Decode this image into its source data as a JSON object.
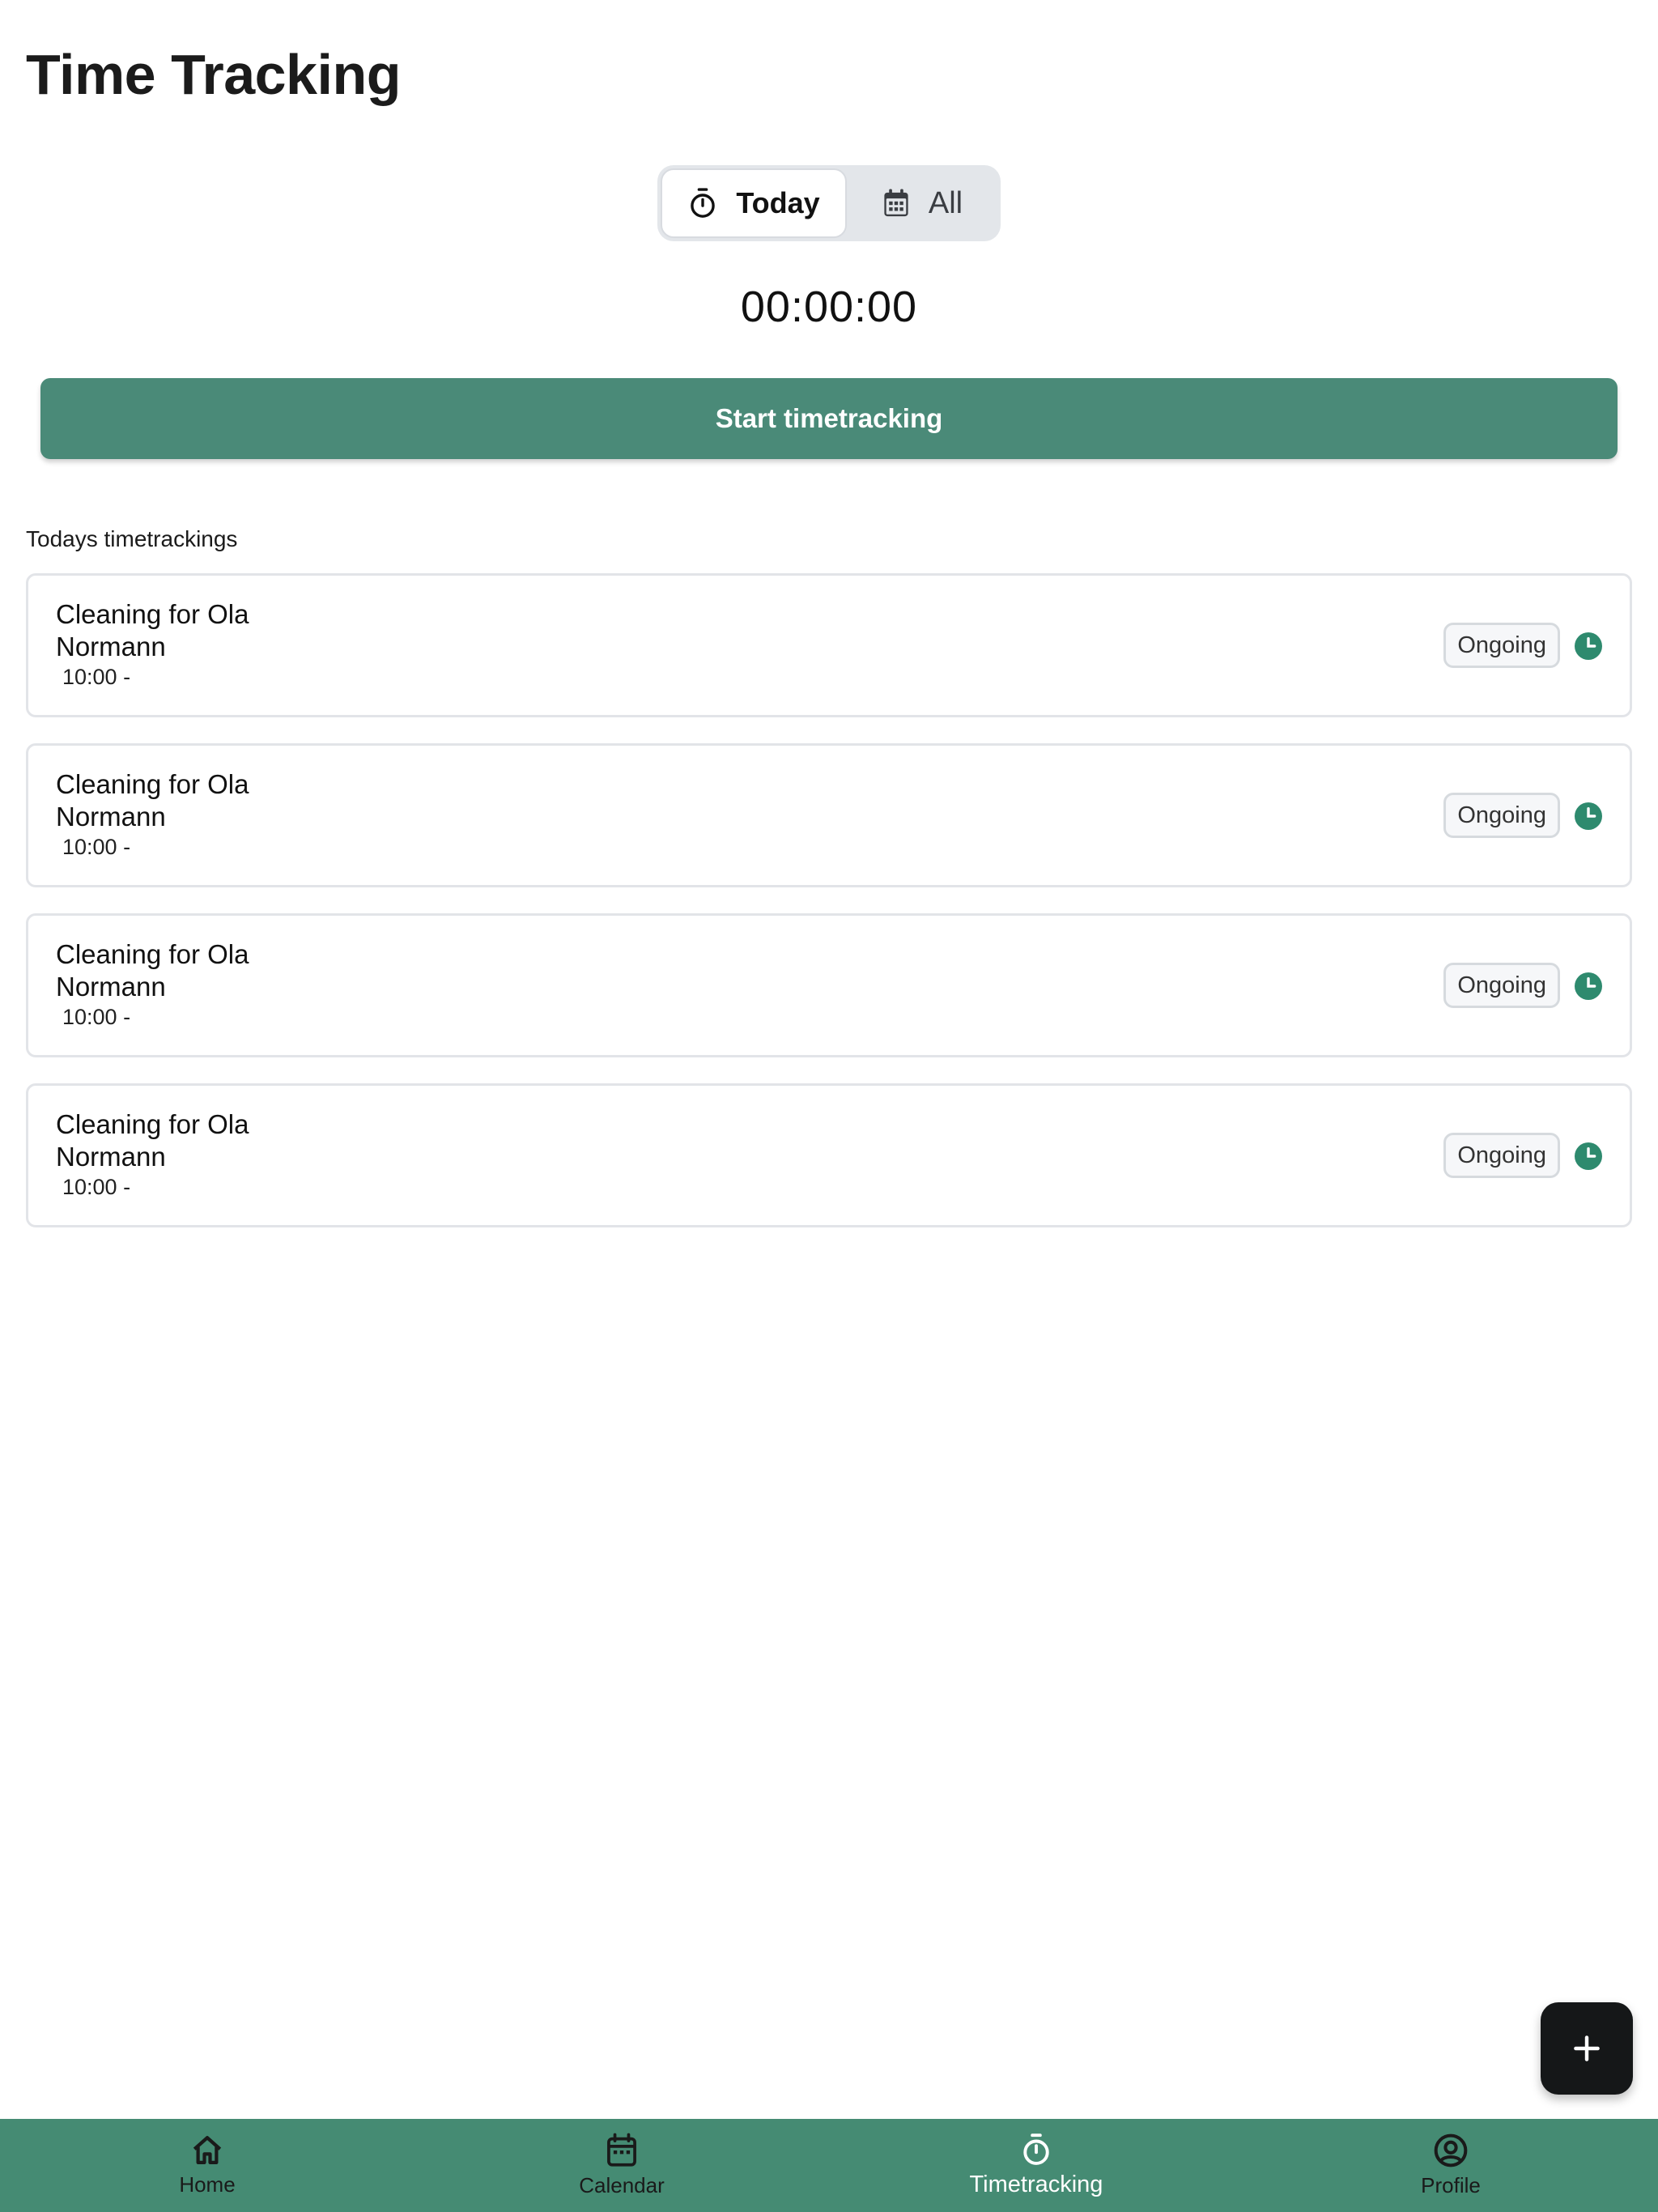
{
  "header": {
    "title": "Time Tracking"
  },
  "view_toggle": {
    "options": [
      {
        "label": "Today",
        "icon": "stopwatch-icon",
        "selected": true
      },
      {
        "label": "All",
        "icon": "calendar-icon",
        "selected": false
      }
    ]
  },
  "timer": {
    "value": "00:00:00"
  },
  "start_button": {
    "label": "Start timetracking"
  },
  "section": {
    "label": "Todays timetrackings"
  },
  "entries": [
    {
      "title": "Cleaning for Ola Normann",
      "time": "10:00 -",
      "status": "Ongoing",
      "status_icon": "clock-icon"
    },
    {
      "title": "Cleaning for Ola Normann",
      "time": "10:00 -",
      "status": "Ongoing",
      "status_icon": "clock-icon"
    },
    {
      "title": "Cleaning for Ola Normann",
      "time": "10:00 -",
      "status": "Ongoing",
      "status_icon": "clock-icon"
    },
    {
      "title": "Cleaning for Ola Normann",
      "time": "10:00 -",
      "status": "Ongoing",
      "status_icon": "clock-icon"
    }
  ],
  "fab": {
    "icon": "plus-icon"
  },
  "bottom_nav": {
    "items": [
      {
        "label": "Home",
        "icon": "home-icon",
        "active": false
      },
      {
        "label": "Calendar",
        "icon": "calendar-icon",
        "active": false
      },
      {
        "label": "Timetracking",
        "icon": "stopwatch-icon",
        "active": true
      },
      {
        "label": "Profile",
        "icon": "profile-icon",
        "active": false
      }
    ]
  },
  "colors": {
    "accent": "#4a8a78",
    "nav_background": "#458b73",
    "status_green": "#2e8a6e",
    "fab_background": "#151718"
  }
}
